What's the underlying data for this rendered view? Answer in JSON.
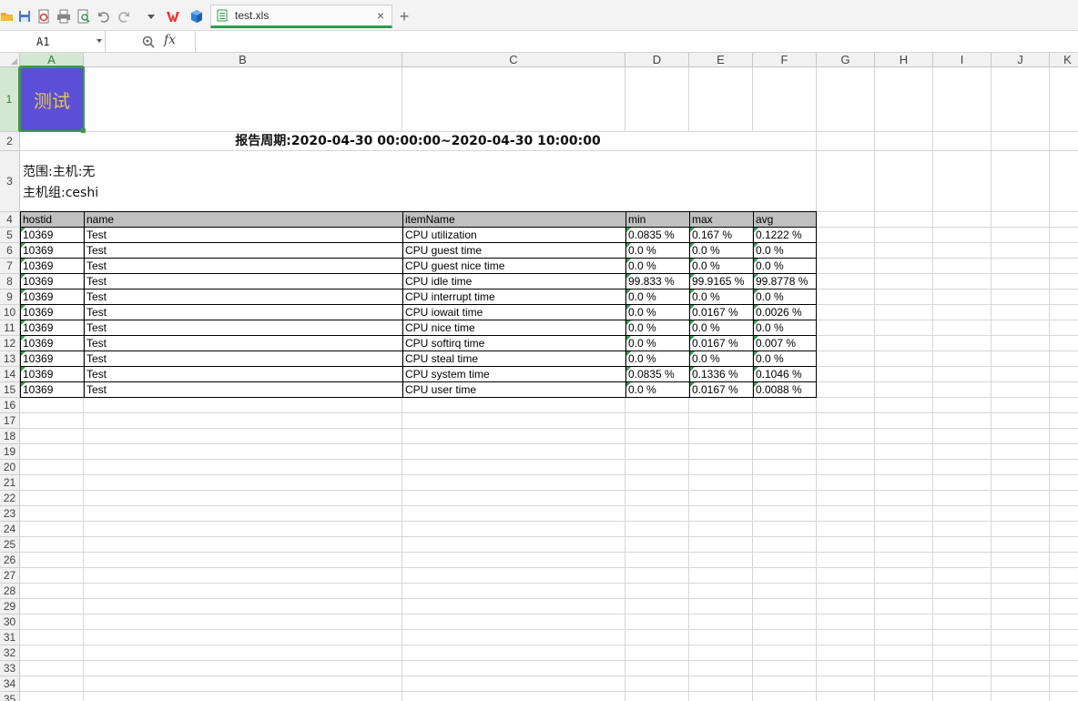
{
  "app": {
    "tab": {
      "label": "test.xls",
      "close_glyph": "×"
    },
    "new_tab_glyph": "+",
    "toolbar_icons": [
      "open-folder-icon",
      "save-icon",
      "export-pdf-icon",
      "print-icon",
      "print-preview-icon",
      "undo-icon",
      "redo-icon",
      "dropdown-icon",
      "wps-logo-icon",
      "cube-icon"
    ],
    "brand_color": "#e8322d",
    "accent_color": "#2e9c4a"
  },
  "formula_bar": {
    "name_box": "A1",
    "fx_label": "fx",
    "formula_value": ""
  },
  "columns": [
    "A",
    "B",
    "C",
    "D",
    "E",
    "F",
    "G",
    "H",
    "I",
    "J",
    "K"
  ],
  "rows": [
    "1",
    "2",
    "3",
    "4",
    "5",
    "6",
    "7",
    "8",
    "9",
    "10",
    "11",
    "12",
    "13",
    "14",
    "15",
    "16",
    "17",
    "18",
    "19",
    "20",
    "21",
    "22",
    "23",
    "24",
    "25",
    "26",
    "27",
    "28",
    "29",
    "30",
    "31",
    "32",
    "33",
    "34",
    "35"
  ],
  "selected_cell": {
    "column": "A",
    "row": "1"
  },
  "sheet": {
    "a1_text": "测试",
    "a1_fill": "#5a4fd6",
    "a1_text_color": "#e8c25a",
    "report_period": "报告周期:2020-04-30 00:00:00~2020-04-30 10:00:00",
    "scope_line1": "范围:主机:无",
    "scope_line2": "主机组:ceshi",
    "table": {
      "headers": [
        "hostid",
        "name",
        "itemName",
        "min",
        "max",
        "avg"
      ],
      "rows": [
        [
          "10369",
          "Test",
          "CPU utilization",
          "0.0835 %",
          "0.167 %",
          "0.1222 %"
        ],
        [
          "10369",
          "Test",
          "CPU guest time",
          "0.0 %",
          "0.0 %",
          "0.0 %"
        ],
        [
          "10369",
          "Test",
          "CPU guest nice time",
          "0.0 %",
          "0.0 %",
          "0.0 %"
        ],
        [
          "10369",
          "Test",
          "CPU idle time",
          "99.833 %",
          "99.9165 %",
          "99.8778 %"
        ],
        [
          "10369",
          "Test",
          "CPU interrupt time",
          "0.0 %",
          "0.0 %",
          "0.0 %"
        ],
        [
          "10369",
          "Test",
          "CPU iowait time",
          "0.0 %",
          "0.0167 %",
          "0.0026 %"
        ],
        [
          "10369",
          "Test",
          "CPU nice time",
          "0.0 %",
          "0.0 %",
          "0.0 %"
        ],
        [
          "10369",
          "Test",
          "CPU softirq time",
          "0.0 %",
          "0.0167 %",
          "0.007 %"
        ],
        [
          "10369",
          "Test",
          "CPU steal time",
          "0.0 %",
          "0.0 %",
          "0.0 %"
        ],
        [
          "10369",
          "Test",
          "CPU system time",
          "0.0835 %",
          "0.1336 %",
          "0.1046 %"
        ],
        [
          "10369",
          "Test",
          "CPU user time",
          "0.0 %",
          "0.0167 %",
          "0.0088 %"
        ]
      ]
    }
  }
}
